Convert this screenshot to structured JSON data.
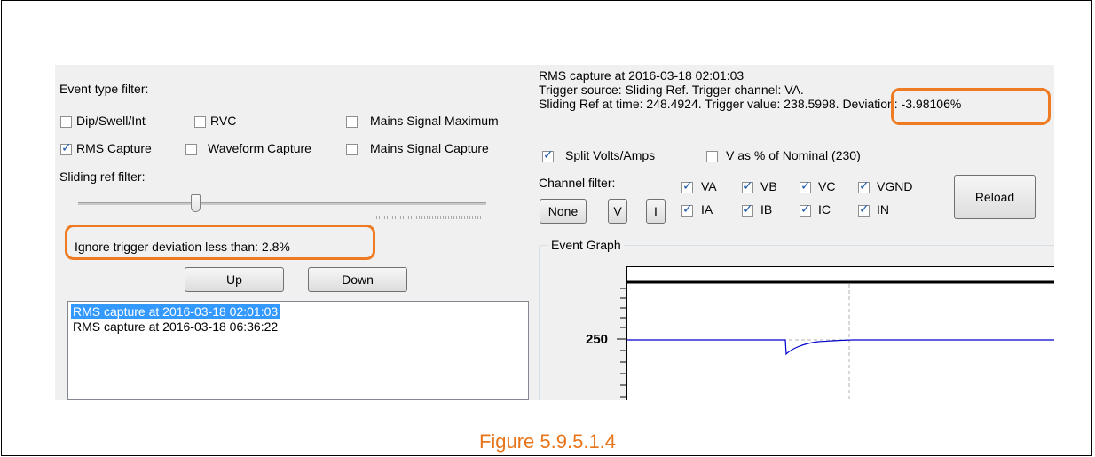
{
  "figure_caption": "Figure 5.9.5.1.4",
  "left_panel": {
    "event_type_filter_label": "Event type filter:",
    "checkboxes": [
      {
        "label": "Dip/Swell/Int",
        "checked": false
      },
      {
        "label": "RVC",
        "checked": false
      },
      {
        "label": "Mains Signal Maximum",
        "checked": false
      },
      {
        "label": "RMS Capture",
        "checked": true
      },
      {
        "label": "Waveform Capture",
        "checked": false
      },
      {
        "label": "Mains Signal Capture",
        "checked": false
      }
    ],
    "sliding_ref_filter_label": "Sliding ref filter:",
    "ignore_deviation_text": "Ignore trigger deviation less than: 2.8%",
    "up_button": "Up",
    "down_button": "Down",
    "event_list": [
      {
        "text": "RMS capture at 2016-03-18 02:01:03",
        "selected": true
      },
      {
        "text": "RMS capture at 2016-03-18 06:36:22",
        "selected": false
      }
    ]
  },
  "right_panel": {
    "info_line_1": "RMS capture at 2016-03-18 02:01:03",
    "info_line_2": "Trigger source: Sliding Ref. Trigger channel: VA.",
    "info_line_3": "Sliding Ref at time: 248.4924. Trigger value: 238.5998. Deviation: -3.98106%",
    "split_volts_amps": {
      "label": "Split Volts/Amps",
      "checked": true
    },
    "v_percent_nominal": {
      "label": "V as % of Nominal (230)",
      "checked": false
    },
    "channel_filter_label": "Channel filter:",
    "none_button": "None",
    "v_button": "V",
    "i_button": "I",
    "channels": [
      {
        "label": "VA",
        "checked": true
      },
      {
        "label": "VB",
        "checked": true
      },
      {
        "label": "VC",
        "checked": true
      },
      {
        "label": "VGND",
        "checked": true
      },
      {
        "label": "IA",
        "checked": true
      },
      {
        "label": "IB",
        "checked": true
      },
      {
        "label": "IC",
        "checked": true
      },
      {
        "label": "IN",
        "checked": true
      }
    ],
    "reload_button": "Reload",
    "event_graph_label": "Event Graph",
    "y_tick_label": "250"
  },
  "colors": {
    "highlight_box": "#ee7a22",
    "caption": "#e8751a",
    "selection": "#3399ff",
    "trace": "#0000cc"
  }
}
